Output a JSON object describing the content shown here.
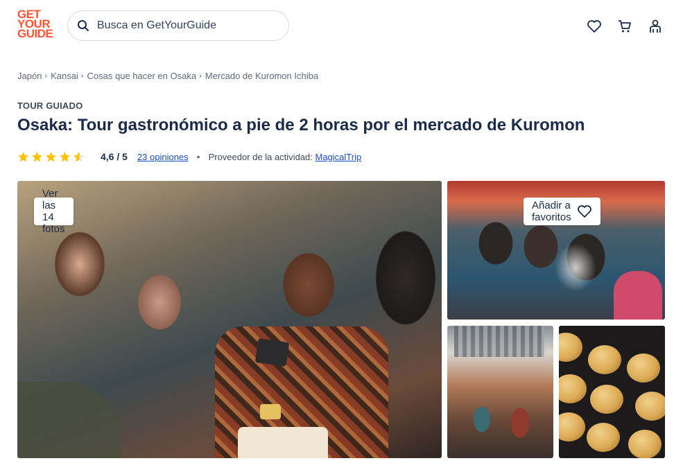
{
  "header": {
    "logo_lines": [
      "GET",
      "YOUR",
      "GUIDE"
    ],
    "search_placeholder": "Busca en GetYourGuide",
    "icons": [
      "heart-icon",
      "cart-icon",
      "profile-icon"
    ],
    "brand_color": "#ff5533"
  },
  "breadcrumb": [
    {
      "label": "Japón"
    },
    {
      "label": "Kansai"
    },
    {
      "label": "Cosas que hacer en Osaka"
    },
    {
      "label": "Mercado de Kuromon Ichiba"
    }
  ],
  "activity": {
    "category": "TOUR GUIADO",
    "title": "Osaka: Tour gastronómico a pie de 2 horas por el mercado de Kuromon",
    "rating": 4.6,
    "rating_text": "4,6 / 5",
    "reviews_text": "23 opiniones",
    "separator": "•",
    "provider_label": "Proveedor de la actividad:",
    "provider_name": "MagicalTrip"
  },
  "gallery": {
    "view_photos_label": "Ver las 14 fotos",
    "favorite_label": "Añadir a favoritos"
  },
  "colors": {
    "star": "#ffc107",
    "link": "#1a4dc9",
    "text": "#1a2b49"
  }
}
